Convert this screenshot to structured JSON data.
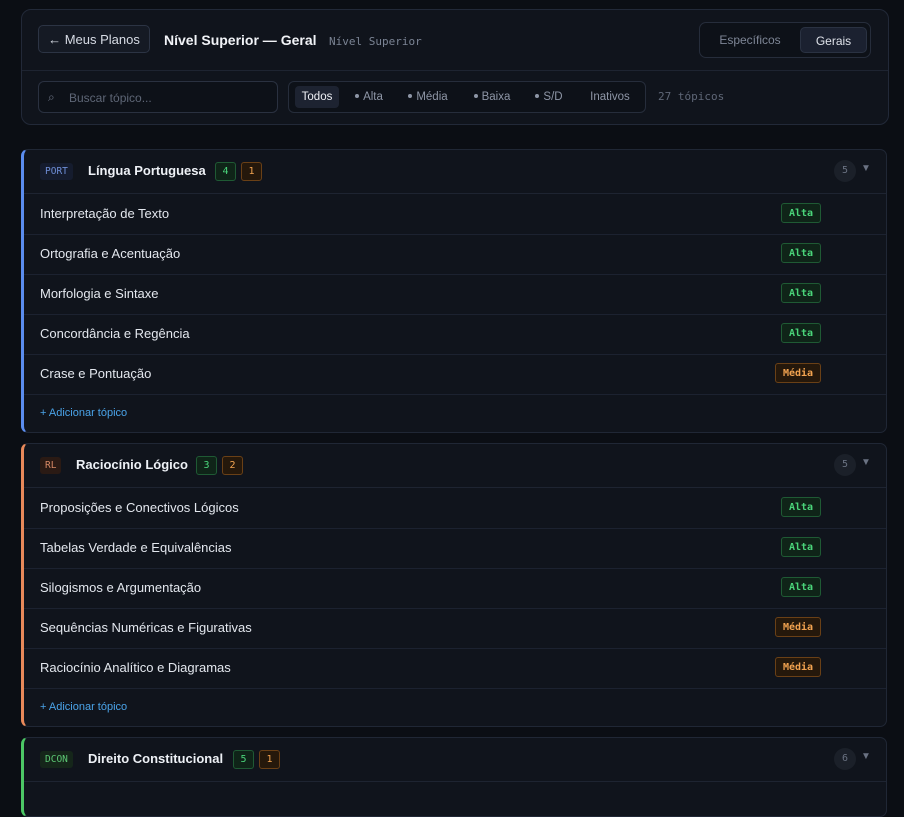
{
  "header": {
    "back_label": "← Meus Planos",
    "title": "Nível Superior — Geral",
    "subtitle": "Nível Superior",
    "toggle": [
      "Específicos",
      "Gerais"
    ],
    "toggle_active": "Gerais"
  },
  "toolbar": {
    "search_placeholder": "Buscar tópico...",
    "filters": [
      "Todos",
      "Alta",
      "Média",
      "Baixa",
      "S/D",
      "Inativos"
    ],
    "active_filter": "Todos",
    "topic_count": "27 tópicos"
  },
  "colors": {
    "portuguese": "#5b8def",
    "logic": "#e8895a",
    "constitutional": "#4cc765",
    "alta": "#4ad57a",
    "media": "#f2a350",
    "add_link": "#4aa3e8"
  },
  "sections": [
    {
      "code": "PORT",
      "name": "Língua Portuguesa",
      "counts": [
        "4",
        "1"
      ],
      "total": "5",
      "add_label": "+ Adicionar tópico",
      "topics": [
        {
          "name": "Interpretação de Texto",
          "priority": "Alta"
        },
        {
          "name": "Ortografia e Acentuação",
          "priority": "Alta"
        },
        {
          "name": "Morfologia e Sintaxe",
          "priority": "Alta"
        },
        {
          "name": "Concordância e Regência",
          "priority": "Alta"
        },
        {
          "name": "Crase e Pontuação",
          "priority": "Média"
        }
      ]
    },
    {
      "code": "RL",
      "name": "Raciocínio Lógico",
      "counts": [
        "3",
        "2"
      ],
      "total": "5",
      "add_label": "+ Adicionar tópico",
      "topics": [
        {
          "name": "Proposições e Conectivos Lógicos",
          "priority": "Alta"
        },
        {
          "name": "Tabelas Verdade e Equivalências",
          "priority": "Alta"
        },
        {
          "name": "Silogismos e Argumentação",
          "priority": "Alta"
        },
        {
          "name": "Sequências Numéricas e Figurativas",
          "priority": "Média"
        },
        {
          "name": "Raciocínio Analítico e Diagramas",
          "priority": "Média"
        }
      ]
    },
    {
      "code": "DCON",
      "name": "Direito Constitucional",
      "counts": [
        "5",
        "1"
      ],
      "total": "6",
      "topics": []
    }
  ]
}
